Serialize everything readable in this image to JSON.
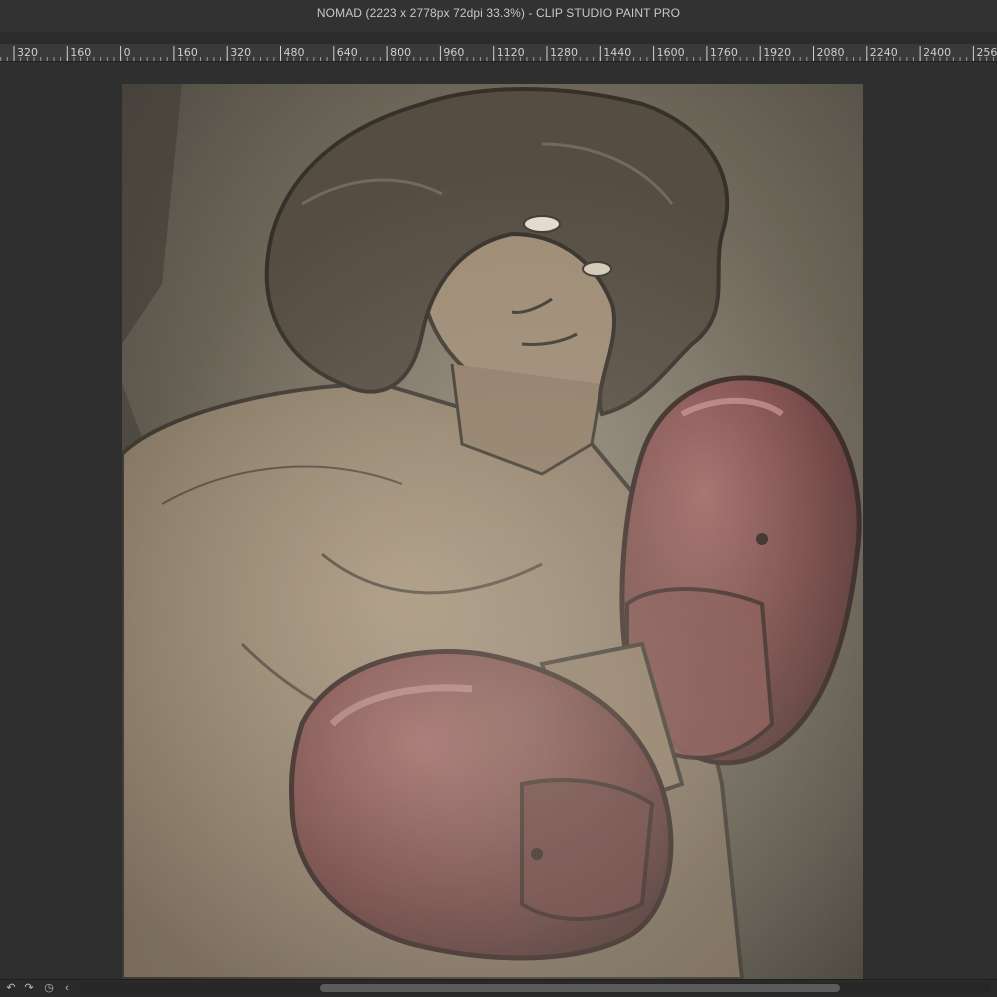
{
  "window": {
    "title": "NOMAD (2223 x 2778px 72dpi 33.3%)  - CLIP STUDIO PAINT PRO"
  },
  "ruler": {
    "labels": [
      "320",
      "160",
      "0",
      "160",
      "320",
      "480",
      "640",
      "800",
      "960",
      "1120",
      "1280",
      "1440",
      "1600",
      "1760",
      "1920",
      "2080",
      "2240",
      "2400",
      "256"
    ]
  },
  "canvas": {
    "artwork": "boxer-illustration",
    "colors": {
      "background": "#4a463e",
      "skin": "#8c7b66",
      "hair": "#3d362d",
      "glove": "#6e3a3c",
      "glove_highlight": "#b27a7b"
    }
  },
  "statusbar": {
    "icons": [
      "undo-icon",
      "redo-icon",
      "rotate-reset-icon",
      "collapse-icon"
    ],
    "glyphs": [
      "↶",
      "↷",
      "◷",
      "‹"
    ]
  }
}
